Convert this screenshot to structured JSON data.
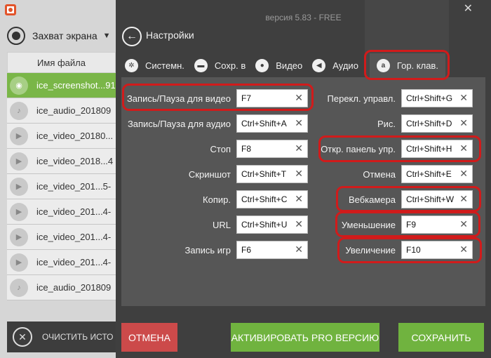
{
  "left_app": {
    "capture_label": "Захват экрана",
    "column_header": "Имя файла",
    "files": [
      {
        "name": "ice_screenshot...91",
        "type": "screenshot",
        "selected": true
      },
      {
        "name": "ice_audio_201809",
        "type": "audio",
        "selected": false
      },
      {
        "name": "ice_video_20180...",
        "type": "video",
        "selected": false
      },
      {
        "name": "ice_video_2018...4",
        "type": "video",
        "selected": false
      },
      {
        "name": "ice_video_201...5-",
        "type": "video",
        "selected": false
      },
      {
        "name": "ice_video_201...4-",
        "type": "video",
        "selected": false
      },
      {
        "name": "ice_video_201...4-",
        "type": "video",
        "selected": false
      },
      {
        "name": "ice_video_201...4-",
        "type": "video",
        "selected": false
      },
      {
        "name": "ice_audio_201809",
        "type": "audio",
        "selected": false
      }
    ],
    "clear_label": "ОЧИСТИТЬ ИСТО"
  },
  "dialog": {
    "version": "версия 5.83 - FREE",
    "title": "Настройки",
    "tabs": [
      {
        "label": "Системн.",
        "icon": "gear-icon"
      },
      {
        "label": "Сохр. в",
        "icon": "folder-icon"
      },
      {
        "label": "Видео",
        "icon": "record-icon"
      },
      {
        "label": "Аудио",
        "icon": "speaker-icon"
      },
      {
        "label": "Гор. клав.",
        "icon": "hotkey-icon",
        "active": true
      }
    ],
    "hotkeys_left": [
      {
        "label": "Запись/Пауза для видео",
        "value": "F7"
      },
      {
        "label": "Запись/Пауза для аудио",
        "value": "Ctrl+Shift+A"
      },
      {
        "label": "Стоп",
        "value": "F8"
      },
      {
        "label": "Скриншот",
        "value": "Ctrl+Shift+T"
      },
      {
        "label": "Копир.",
        "value": "Ctrl+Shift+C"
      },
      {
        "label": "URL",
        "value": "Ctrl+Shift+U"
      },
      {
        "label": "Запись игр",
        "value": "F6"
      }
    ],
    "hotkeys_right": [
      {
        "label": "Перекл. управл.",
        "value": "Ctrl+Shift+G"
      },
      {
        "label": "Рис.",
        "value": "Ctrl+Shift+D"
      },
      {
        "label": "Откр. панель упр.",
        "value": "Ctrl+Shift+H"
      },
      {
        "label": "Отмена",
        "value": "Ctrl+Shift+E"
      },
      {
        "label": "Вебкамера",
        "value": "Ctrl+Shift+W"
      },
      {
        "label": "Уменьшение",
        "value": "F9"
      },
      {
        "label": "Увеличение",
        "value": "F10"
      }
    ],
    "buttons": {
      "cancel": "ОТМЕНА",
      "pro": "АКТИВИРОВАТЬ PRO ВЕРСИЮ",
      "save": "СОХРАНИТЬ"
    }
  },
  "colors": {
    "accent_green": "#70b33f",
    "cancel_red": "#cc4a4a",
    "highlight_red": "#d11b1b",
    "dialog_bg": "#3f3f3f"
  }
}
